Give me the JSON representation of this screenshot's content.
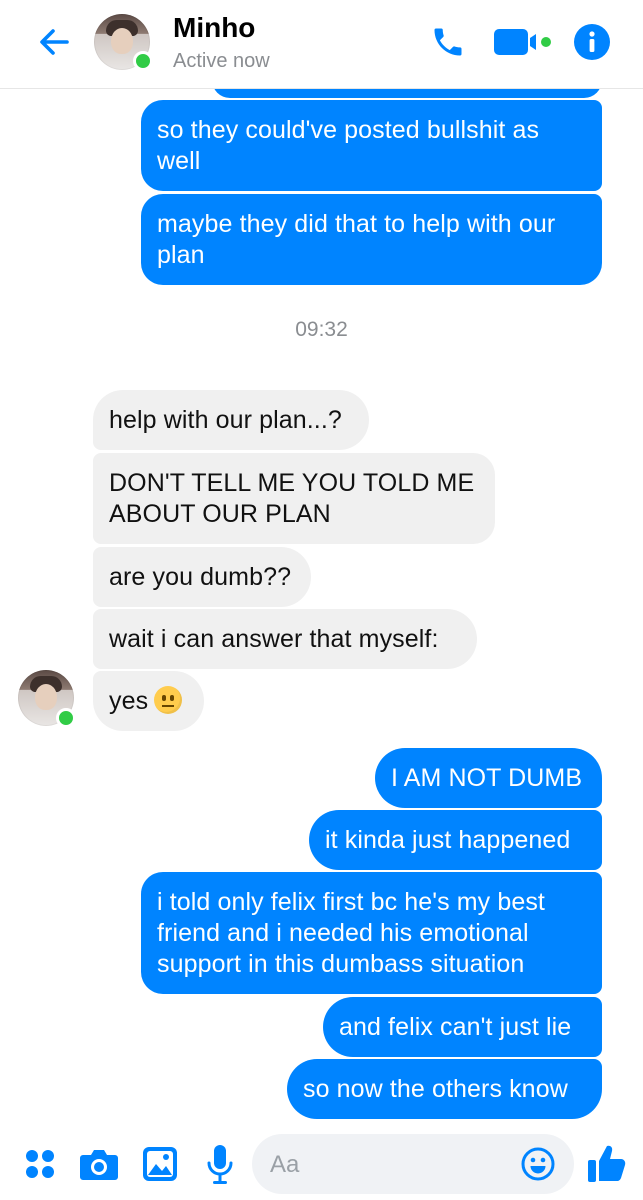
{
  "header": {
    "contact_name": "Minho",
    "status": "Active now",
    "back_icon": "arrow-left-icon",
    "call_icon": "phone-icon",
    "video_icon": "video-camera-icon",
    "info_icon": "info-icon",
    "accent_color": "#0084ff"
  },
  "messages": {
    "out_1": "so they could've posted bullshit as well",
    "out_2": "maybe they did that to help with our plan",
    "timestamp": "09:32",
    "in_1": "help with our plan...?",
    "in_2": "DON'T TELL ME YOU TOLD ME ABOUT OUR PLAN",
    "in_3": "are you dumb??",
    "in_4": "wait i can answer that myself:",
    "in_5": "yes",
    "out_3": "I AM NOT DUMB",
    "out_4": "it kinda just happened",
    "out_5": "i told only felix first bc he's my best friend and i needed his emotional support in this dumbass situation",
    "out_6": "and felix can't just lie",
    "out_7": "so now the others know"
  },
  "composer": {
    "placeholder": "Aa",
    "icons": [
      "apps-icon",
      "camera-icon",
      "image-icon",
      "microphone-icon",
      "emoji-icon",
      "thumbs-up-icon"
    ]
  },
  "colors": {
    "outgoing_bubble": "#0084ff",
    "incoming_bubble": "#f0f0f0",
    "online": "#31cc46"
  }
}
